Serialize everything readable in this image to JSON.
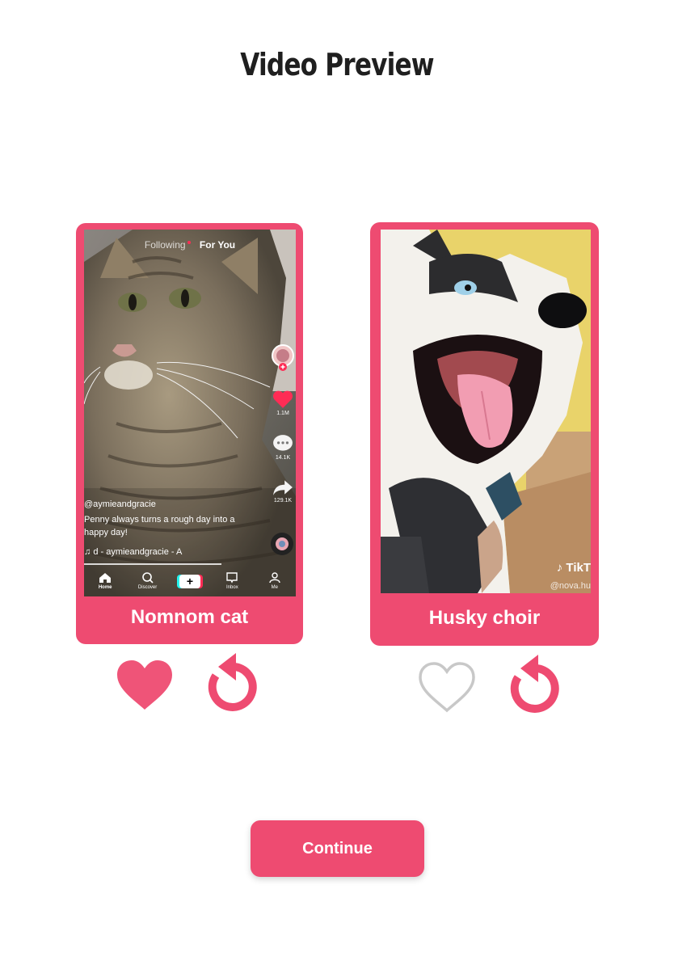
{
  "page": {
    "title": "Video Preview"
  },
  "colors": {
    "accent": "#ee4b71",
    "background": "#ffffff",
    "heart_outline": "#c8c8c8"
  },
  "videos": [
    {
      "label": "Nomnom cat",
      "liked": true,
      "thumbnail": {
        "subject": "tabby-cat",
        "top_tabs": {
          "following": "Following",
          "for_you": "For You"
        },
        "likes": "1.1M",
        "comments": "14.1K",
        "shares": "129.1K",
        "username": "@aymieandgracie",
        "caption": "Penny always turns a rough day into a happy day!",
        "sound": "d - aymieandgracie - A",
        "nav": {
          "home": "Home",
          "discover": "Discover",
          "inbox": "Inbox",
          "me": "Me"
        }
      },
      "like_icon": "heart-filled-icon",
      "replay_icon": "replay-icon"
    },
    {
      "label": "Husky choir",
      "liked": false,
      "thumbnail": {
        "subject": "husky-dog",
        "watermark": "TikT",
        "handle": "@nova.hu"
      },
      "like_icon": "heart-outline-icon",
      "replay_icon": "replay-icon"
    }
  ],
  "continue_button": {
    "label": "Continue"
  }
}
